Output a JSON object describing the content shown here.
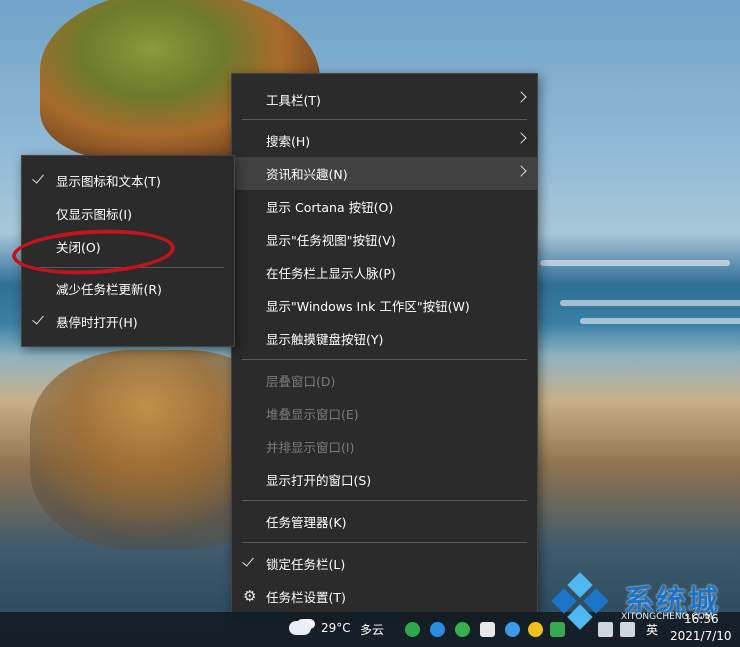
{
  "main_menu": {
    "items": [
      {
        "label": "工具栏(T)",
        "submenu": true
      },
      {
        "label": "搜索(H)",
        "submenu": true
      },
      {
        "label": "资讯和兴趣(N)",
        "submenu": true,
        "highlighted": true
      },
      {
        "label": "显示 Cortana 按钮(O)"
      },
      {
        "label": "显示\"任务视图\"按钮(V)"
      },
      {
        "label": "在任务栏上显示人脉(P)"
      },
      {
        "label": "显示\"Windows Ink 工作区\"按钮(W)"
      },
      {
        "label": "显示触摸键盘按钮(Y)"
      },
      {
        "label": "层叠窗口(D)",
        "disabled": true
      },
      {
        "label": "堆叠显示窗口(E)",
        "disabled": true
      },
      {
        "label": "并排显示窗口(I)",
        "disabled": true
      },
      {
        "label": "显示打开的窗口(S)"
      },
      {
        "label": "任务管理器(K)"
      },
      {
        "label": "锁定任务栏(L)",
        "checked": true
      },
      {
        "label": "任务栏设置(T)",
        "icon": "gear-icon"
      }
    ]
  },
  "sub_menu": {
    "items": [
      {
        "label": "显示图标和文本(T)",
        "checked": true
      },
      {
        "label": "仅显示图标(I)"
      },
      {
        "label": "关闭(O)",
        "annotated": true
      },
      {
        "label": "减少任务栏更新(R)"
      },
      {
        "label": "悬停时打开(H)",
        "checked": true
      }
    ]
  },
  "taskbar": {
    "weather_temp": "29°C",
    "weather_desc": "多云",
    "ime": "英",
    "time": "16:36",
    "date": "2021/7/10"
  },
  "watermark": {
    "title": "系统城",
    "url": "XITONGCHENG.COM"
  },
  "colors": {
    "menu_bg": "#2b2b2b",
    "highlight": "#414141",
    "annotation": "#c0161b",
    "watermark_blue": "#1c74c6"
  }
}
